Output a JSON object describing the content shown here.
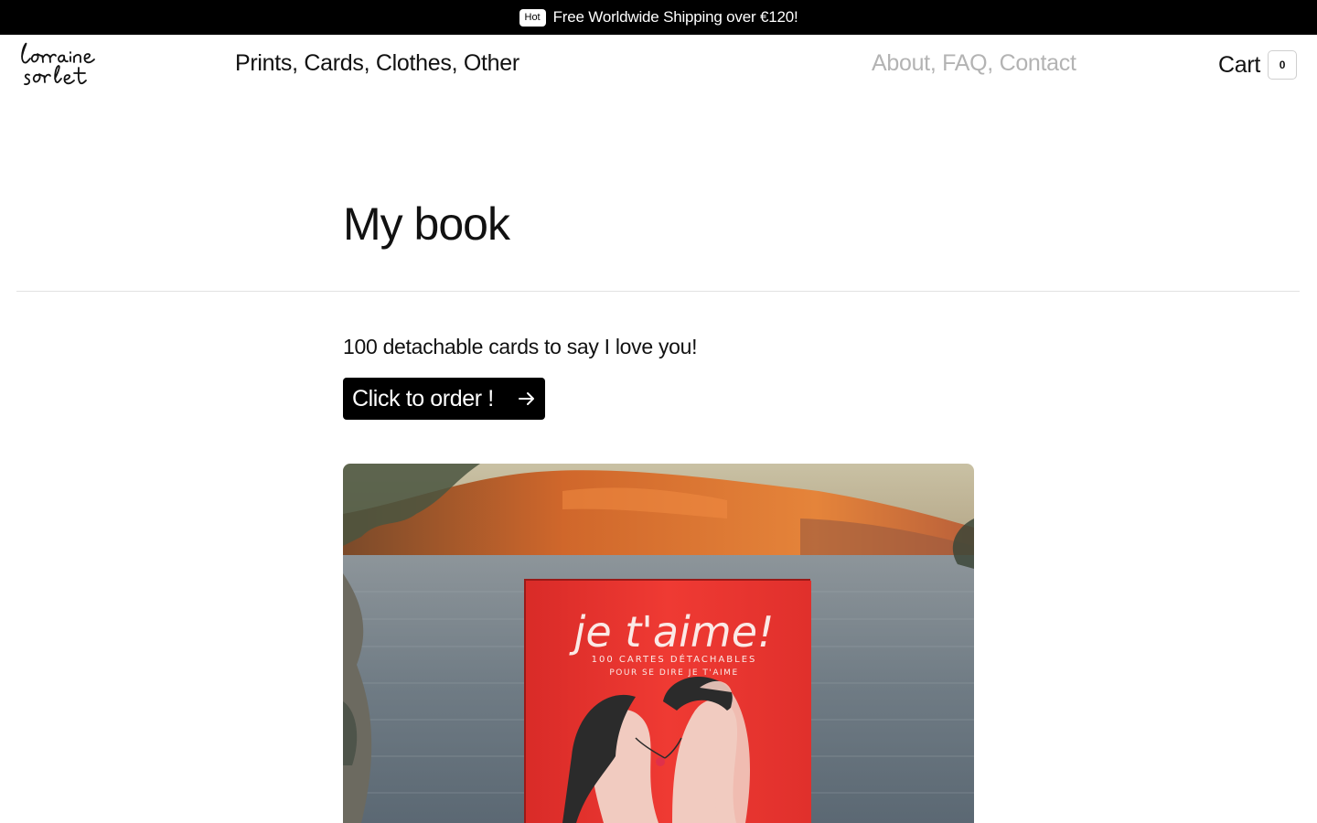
{
  "announcement": {
    "badge": "Hot",
    "message": "Free Worldwide Shipping over €120!"
  },
  "header": {
    "logo_text": "lorraine sorlet",
    "nav_left": [
      "Prints",
      "Cards",
      "Clothes",
      "Other"
    ],
    "nav_right": [
      "About",
      "FAQ",
      "Contact"
    ],
    "cart_label": "Cart",
    "cart_count": "0"
  },
  "main": {
    "title": "My book",
    "subtitle": "100 detachable cards to say I love you!",
    "order_button": "Click to order !"
  },
  "hero": {
    "book_title": "je t'aime!",
    "book_line1": "100 CARTES DÉTACHABLES",
    "book_line2": "POUR SE DIRE JE T'AIME"
  },
  "colors": {
    "announcement_bg": "#000000",
    "nav_inactive": "#b3b3b3",
    "button_bg": "#000000",
    "book_red": "#e8322e"
  }
}
